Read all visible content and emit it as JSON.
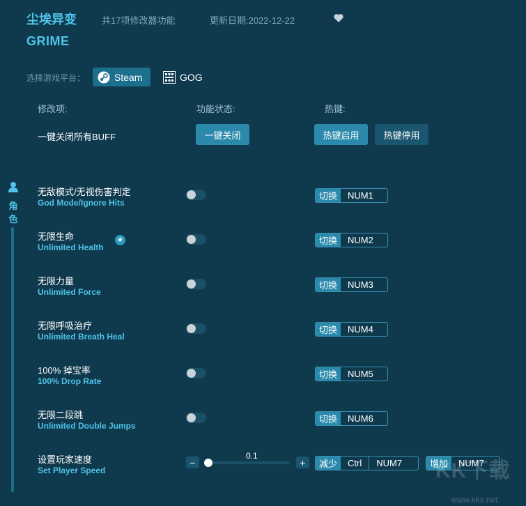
{
  "header": {
    "title_cn": "尘埃异变",
    "feature_count": "共17项修改器功能",
    "update_date": "更新日期:2022-12-22",
    "title_en": "GRIME"
  },
  "platform": {
    "label": "选择游戏平台：",
    "options": [
      "Steam",
      "GOG"
    ],
    "selected": "Steam"
  },
  "columns": {
    "mod": "修改项:",
    "status": "功能状态:",
    "hotkey": "热键:"
  },
  "buff": {
    "label": "一键关闭所有BUFF",
    "close_button": "一键关闭",
    "hotkey_on": "热键启用",
    "hotkey_off": "热键停用"
  },
  "side_tab": {
    "label": "角色"
  },
  "toggle_label": "切换",
  "rows": [
    {
      "cn": "无敌模式/无视伤害判定",
      "en": "God Mode/Ignore Hits",
      "key": "NUM1",
      "enabled": false
    },
    {
      "cn": "无限生命",
      "en": "Unlimited Health",
      "key": "NUM2",
      "enabled": false,
      "starred": true
    },
    {
      "cn": "无限力量",
      "en": "Unlimited Force",
      "key": "NUM3",
      "enabled": false
    },
    {
      "cn": "无限呼吸治疗",
      "en": "Unlimited Breath Heal",
      "key": "NUM4",
      "enabled": false
    },
    {
      "cn": "100% 掉宝率",
      "en": "100% Drop Rate",
      "key": "NUM5",
      "enabled": false
    },
    {
      "cn": "无限二段跳",
      "en": "Unlimited Double Jumps",
      "key": "NUM6",
      "enabled": false
    }
  ],
  "speed": {
    "cn": "设置玩家速度",
    "en": "Set Player Speed",
    "value": "0.1",
    "decrease_label": "减少",
    "decrease_mod": "Ctrl",
    "decrease_key": "NUM7",
    "increase_label": "增加",
    "increase_key": "NUM7"
  },
  "watermark": {
    "text": "KK下载",
    "url": "www.kkx.net"
  }
}
